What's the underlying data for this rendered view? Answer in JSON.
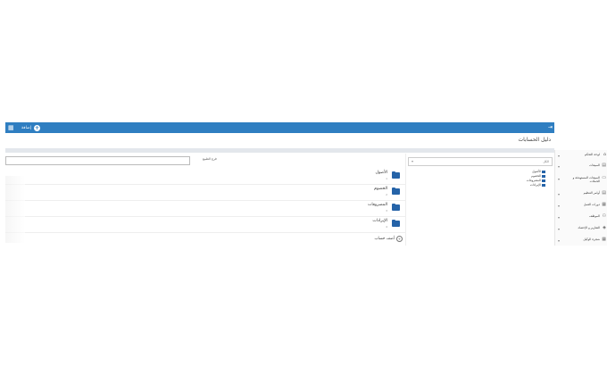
{
  "topbar": {
    "new_label": "إضافة",
    "plus": "+",
    "grid_glyph": "▦",
    "collapse_glyph": "⇥"
  },
  "page": {
    "title": "دليل الحسابات"
  },
  "sidebar": {
    "items": [
      {
        "label": "لوحة التحكم",
        "icon": "⌂"
      },
      {
        "label": "المبيعات",
        "icon": "▤"
      },
      {
        "label": "المبيعات المستهدفة و الحملات",
        "icon": "▭"
      },
      {
        "label": "أوامر التنظيم",
        "icon": "▤"
      },
      {
        "label": "دورات العمل",
        "icon": "▦"
      },
      {
        "label": "الموظف",
        "icon": "⚇"
      },
      {
        "label": "التقارير و الإحصاء",
        "icon": "◈"
      },
      {
        "label": "شجرة الوكيل",
        "icon": "▦"
      }
    ],
    "chevron": "▾"
  },
  "left_panel": {
    "search_label": "فرع الطبيع",
    "accounts": [
      {
        "name": "الأصول",
        "code": "1"
      },
      {
        "name": "الخصوم",
        "code": "2"
      },
      {
        "name": "المصروفات",
        "code": "3"
      },
      {
        "name": "الإيرادات",
        "code": "4"
      }
    ],
    "add_label": "أضف حساب",
    "add_plus": "+"
  },
  "right_panel": {
    "select_value": "الكل",
    "select_caret": "▾",
    "tree": [
      "الأصول",
      "الخصوم",
      "المصروفات",
      "الإيرادات"
    ]
  }
}
